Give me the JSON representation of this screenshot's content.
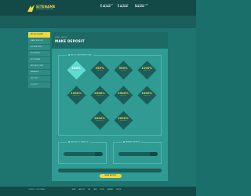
{
  "brand": {
    "name": "SITENAME",
    "tagline": "INVESTMENT PLATFORM"
  },
  "header_stats": [
    {
      "label": "STATS ONLINE",
      "value": "$ 00,000"
    },
    {
      "label": "TOTAL PAID",
      "value": "$ 00,000"
    },
    {
      "label": "RUNNING DAYS",
      "value": "$00,000"
    }
  ],
  "top_info": [
    {
      "label": "REAL AMOUNT",
      "value": "REAL ACCOUNT"
    },
    {
      "label": "INVESTMENT",
      "value": "REAL ACCOUNT"
    },
    {
      "label": "WITHDRAWN",
      "value": "TOTAL AMOUNT"
    }
  ],
  "sidebar": {
    "items": [
      {
        "label": "MY ACCOUNT",
        "active": true
      },
      {
        "label": "MAKE DEPOSIT",
        "active": false
      },
      {
        "label": "MY DEPOSITS",
        "active": false
      },
      {
        "label": "REFERRALS",
        "active": false
      },
      {
        "label": "WITHDRAW",
        "active": false
      },
      {
        "label": "EDIT ACCOUNT",
        "active": false
      },
      {
        "label": "BANNERS",
        "active": false
      },
      {
        "label": "HISTORY",
        "active": false
      },
      {
        "label": "LOGOUT",
        "active": false
      }
    ]
  },
  "breadcrumb": "HOME > DEPOSIT",
  "page_title": "MAKE DEPOSIT",
  "plans_section": {
    "label": "SELECT INVESTMENT PLAN"
  },
  "plans": [
    {
      "percent": "140%",
      "sub": "AFTER 1 DAY",
      "selected": true
    },
    {
      "percent": "350%",
      "sub": "AFTER 3 DAYS",
      "selected": false
    },
    {
      "percent": "550%",
      "sub": "AFTER 5 DAYS",
      "selected": false
    },
    {
      "percent": "1100%",
      "sub": "AFTER 7 DAYS",
      "selected": false
    },
    {
      "percent": "1500%",
      "sub": "AFTER 10 DAYS",
      "selected": false
    },
    {
      "percent": "2000%",
      "sub": "AFTER 12 DAYS",
      "selected": false
    },
    {
      "percent": "2500%",
      "sub": "AFTER 14 DAYS",
      "selected": false
    },
    {
      "percent": "1000%",
      "sub": "AFTER 15 DAYS",
      "selected": false
    },
    {
      "percent": "2000%",
      "sub": "AFTER 20 DAYS",
      "selected": false
    },
    {
      "percent": "2000%",
      "sub": "AFTER 25 DAYS",
      "selected": false
    }
  ],
  "amount_section": {
    "label": "AMOUNT TO SPEND ($)"
  },
  "payment_section": {
    "label": "PAYMENT METHOD"
  },
  "submit_button": "MAKE DEPOSIT",
  "footer": {
    "copyright": "COPYRIGHT © 2016 SITENAME",
    "links": [
      "HOME",
      "ABOUT US",
      "FAQ",
      "NEWS",
      "RULES",
      "BANNERS",
      "SUPPORT"
    ]
  },
  "colors": {
    "accent": "#f2d73c",
    "dark": "#134a48",
    "panel": "#2f9b93",
    "selected": "#5fdcd2"
  }
}
